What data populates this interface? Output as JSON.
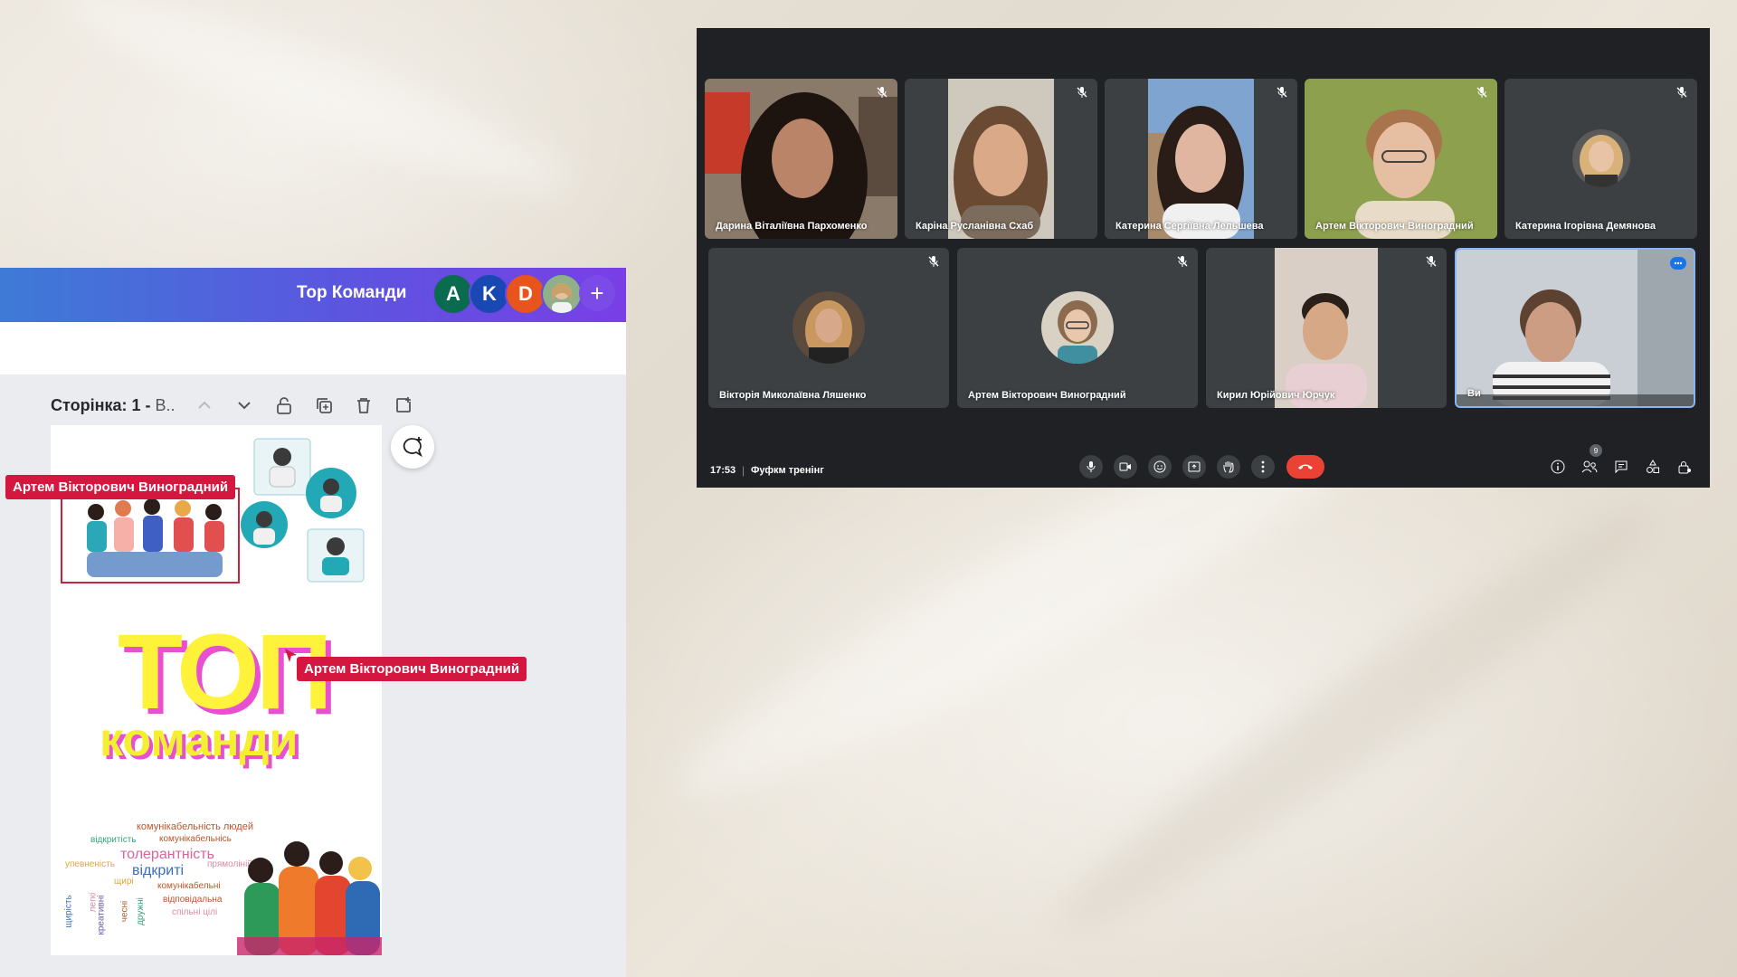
{
  "canva": {
    "title": "Тор Команди",
    "collaborators": [
      {
        "initial": "A",
        "color": "#0b6b4f"
      },
      {
        "initial": "K",
        "color": "#1947b4"
      },
      {
        "initial": "D",
        "color": "#e8541d"
      },
      {
        "initial": "",
        "color": "#2f8a3c"
      }
    ],
    "add_label": "+",
    "page_label_bold": "Сторінка: 1 - ",
    "page_label_rest": "B..",
    "design": {
      "title_top": "ТОП",
      "title_bottom": "команди",
      "word_cloud": [
        {
          "text": "комунікабельність людей",
          "color": "#b8572a",
          "size": 11
        },
        {
          "text": "відкритість",
          "color": "#3aa37a",
          "size": 10
        },
        {
          "text": "комунікабельнісь",
          "color": "#b8572a",
          "size": 10
        },
        {
          "text": "толерантність",
          "color": "#d9649a",
          "size": 16
        },
        {
          "text": "упевненість",
          "color": "#e0a83a",
          "size": 10
        },
        {
          "text": "прямолінійність",
          "color": "#d98aa8",
          "size": 10
        },
        {
          "text": "відкриті",
          "color": "#3a6fb8",
          "size": 16
        },
        {
          "text": "щирі",
          "color": "#e0a83a",
          "size": 10
        },
        {
          "text": "комунікабельні",
          "color": "#b8572a",
          "size": 10
        },
        {
          "text": "відповідальна",
          "color": "#b8572a",
          "size": 10
        },
        {
          "text": "спільні цілі",
          "color": "#d98aa8",
          "size": 10
        },
        {
          "text": "щирість",
          "color": "#3a6fb8",
          "size": 10
        },
        {
          "text": "легкі",
          "color": "#d98aa8",
          "size": 10
        },
        {
          "text": "креативні",
          "color": "#6a5ab0",
          "size": 10
        },
        {
          "text": "чесні",
          "color": "#b8572a",
          "size": 10
        },
        {
          "text": "дружні",
          "color": "#3aa37a",
          "size": 10
        }
      ]
    },
    "cursor_tags": [
      "Артем Вікторович Виноградний",
      "Артем Вікторович Виноградний"
    ]
  },
  "meet": {
    "time": "17:53",
    "separator": "|",
    "meeting_title": "Фуфкм тренінг",
    "people_count": "9",
    "participants": [
      {
        "name": "Дарина Віталіївна Пархоменко",
        "skin": "#b98467",
        "hair": "#1d1410",
        "bg": "#8a7a6a"
      },
      {
        "name": "Каріна Русланівна Схаб",
        "skin": "#d9a988",
        "hair": "#6b4a34",
        "bg": "#cfc8bd"
      },
      {
        "name": "Катерина Сергіївна Лельшева",
        "skin": "#e0b6a0",
        "hair": "#2a1d18",
        "bg": "#7ea4cf"
      },
      {
        "name": "Артем Вікторович Виноградний",
        "skin": "#e6bfa3",
        "hair": "#a9744b",
        "bg": "#8da04e"
      },
      {
        "name": "Катерина Ігорівна Демянова",
        "skin": "#e9c3a6",
        "hair": "#d9b27a",
        "bg": "#3c4043"
      },
      {
        "name": "Вікторія Миколаївна Ляшенко",
        "skin": "#d7a98a",
        "hair": "#c99860",
        "bg": "#3c4043"
      },
      {
        "name": "Артем Вікторович Виноградний",
        "skin": "#e8c7ad",
        "hair": "#8c6a4d",
        "bg": "#3c4043"
      },
      {
        "name": "Кирил Юрійович Юрчук",
        "skin": "#d7a886",
        "hair": "#2b2019",
        "bg": "#d9cfc7"
      },
      {
        "name": "Ви",
        "skin": "#cc9d82",
        "hair": "#5d4131",
        "bg": "#c9cfd4"
      }
    ]
  }
}
